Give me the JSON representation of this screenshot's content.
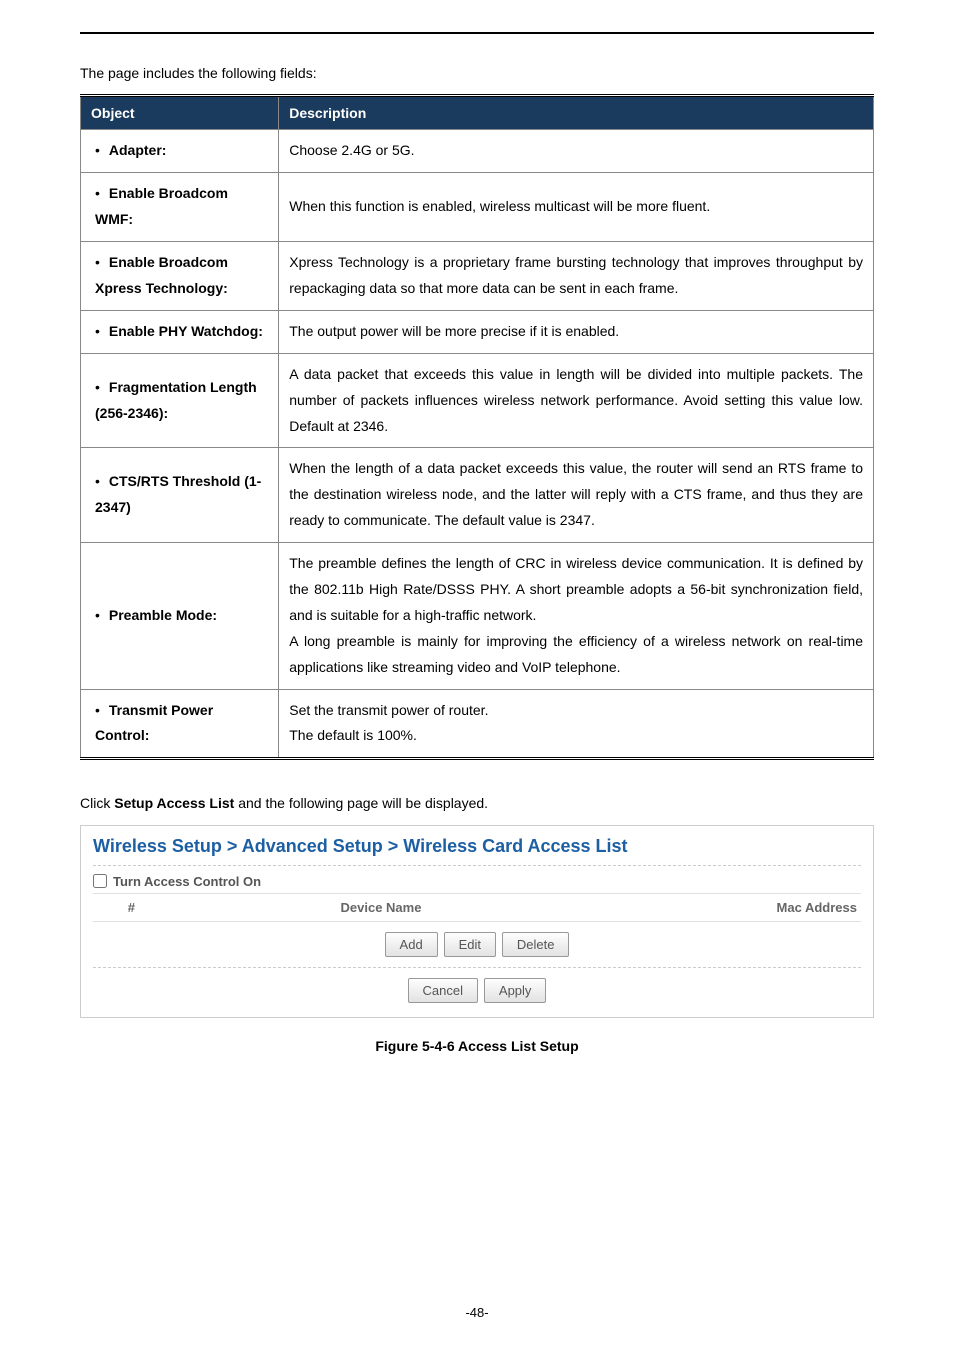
{
  "intro_text": "The page includes the following fields:",
  "table_headers": {
    "object": "Object",
    "description": "Description"
  },
  "rows": [
    {
      "obj": "Adapter:",
      "desc": "Choose 2.4G or 5G."
    },
    {
      "obj": "Enable Broadcom WMF:",
      "desc": "When this function is enabled, wireless multicast will be more fluent."
    },
    {
      "obj": "Enable Broadcom Xpress Technology:",
      "desc": "Xpress Technology is a proprietary frame bursting technology that improves throughput by repackaging data so that more data can be sent in each frame."
    },
    {
      "obj": "Enable PHY Watchdog:",
      "desc": "The output power will be more precise if it is enabled."
    },
    {
      "obj": "Fragmentation Length (256-2346):",
      "desc": "A data packet that exceeds this value in length will be divided into multiple packets. The number of packets influences wireless network performance. Avoid setting this value low. Default at 2346."
    },
    {
      "obj": "CTS/RTS Threshold (1-2347)",
      "desc": "When the length of a data packet exceeds this value, the router will send an RTS frame to the destination wireless node, and the latter will reply with a CTS frame, and thus they are ready to communicate. The default value is 2347."
    },
    {
      "obj": "Preamble Mode:",
      "desc": "The preamble defines the length of CRC in wireless device communication. It is defined by the 802.11b High Rate/DSSS PHY. A short preamble adopts a 56-bit synchronization field, and is suitable for a high-traffic network.\nA long preamble is mainly for improving the efficiency of a wireless network on real-time applications like streaming video and VoIP telephone."
    },
    {
      "obj": "Transmit Power Control:",
      "desc": "Set the transmit power of router.\nThe default is 100%."
    }
  ],
  "click_text_pre": "Click ",
  "click_text_bold": "Setup Access List",
  "click_text_post": " and the following page will be displayed.",
  "panel": {
    "title": "Wireless Setup > Advanced Setup > Wireless Card Access List",
    "checkbox_label": "Turn Access Control On",
    "col_num": "#",
    "col_device": "Device Name",
    "col_mac": "Mac Address",
    "btn_add": "Add",
    "btn_edit": "Edit",
    "btn_delete": "Delete",
    "btn_cancel": "Cancel",
    "btn_apply": "Apply"
  },
  "figure_caption": "Figure 5-4-6 Access List Setup",
  "page_number": "-48-"
}
